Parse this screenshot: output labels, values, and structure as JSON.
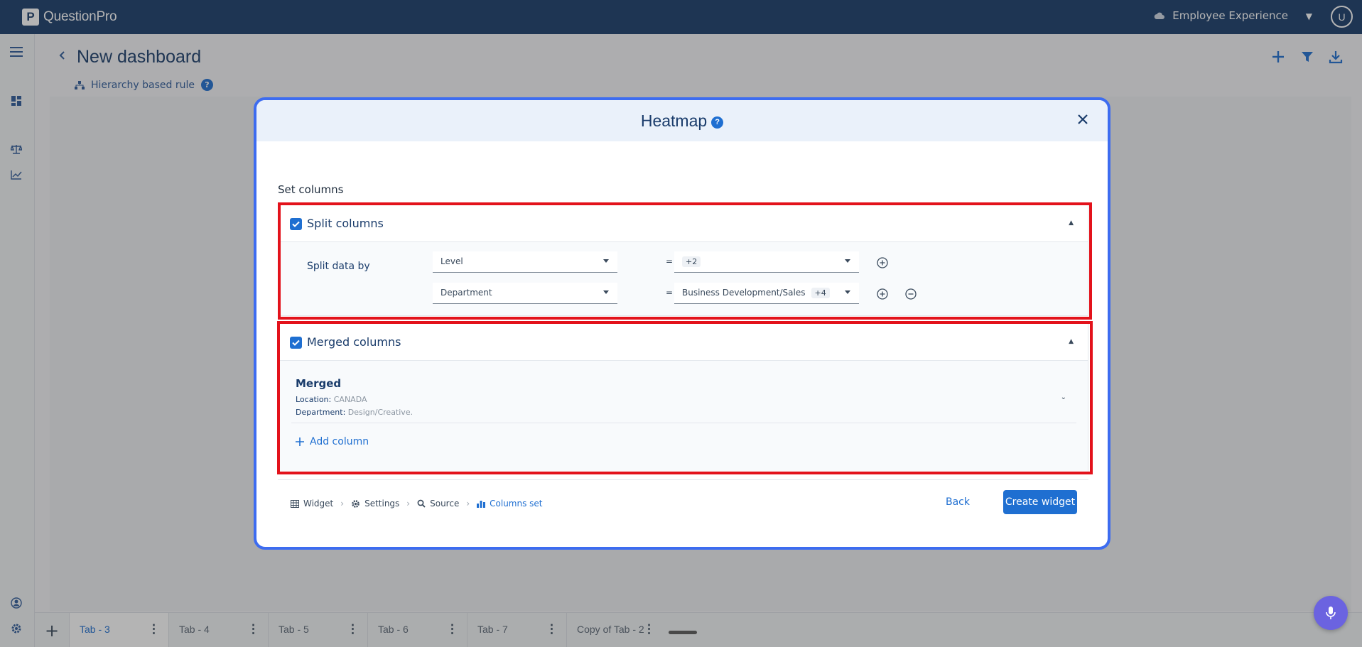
{
  "topbar": {
    "logo_text": "QuestionPro",
    "product": "Employee Experience",
    "user_initial": "U"
  },
  "header": {
    "title": "New dashboard",
    "rule": "Hierarchy based rule"
  },
  "modal": {
    "title": "Heatmap",
    "set_columns": "Set columns",
    "split": {
      "title": "Split columns",
      "label": "Split data by",
      "rows": [
        {
          "field": "Level",
          "op": "=",
          "value": "",
          "chip": "+2"
        },
        {
          "field": "Department",
          "op": "=",
          "value": "Business Development/Sales",
          "chip": "+4"
        }
      ]
    },
    "merged": {
      "title": "Merged columns",
      "item_title": "Merged",
      "lines": [
        {
          "key": "Location:",
          "value": "CANADA"
        },
        {
          "key": "Department:",
          "value": "Design/Creative."
        }
      ],
      "add_column": "Add column"
    },
    "breadcrumbs": [
      "Widget",
      "Settings",
      "Source",
      "Columns set"
    ],
    "back_label": "Back",
    "create_label": "Create widget"
  },
  "tabs": [
    "Tab - 3",
    "Tab - 4",
    "Tab - 5",
    "Tab - 6",
    "Tab - 7",
    "Copy of Tab - 2"
  ],
  "colors": {
    "topbar": "#1a3c6b",
    "accent": "#1f6fd1",
    "modal_border": "#3d6cf0",
    "highlight": "#e3121b",
    "mic": "#6b63e0"
  }
}
